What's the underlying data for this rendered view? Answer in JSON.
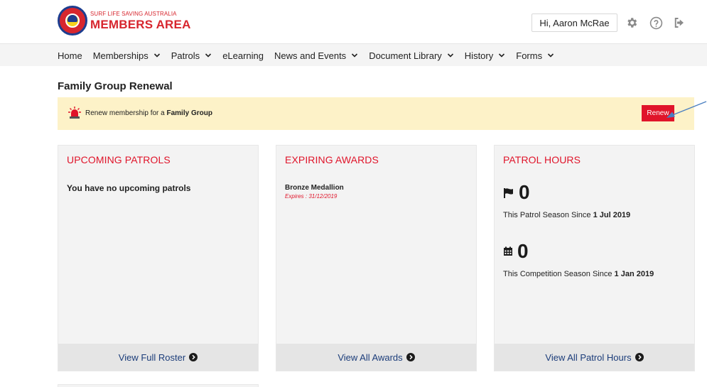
{
  "header": {
    "logo_subtitle": "SURF LIFE SAVING AUSTRALIA",
    "logo_title": "MEMBERS AREA",
    "greeting": "Hi, Aaron McRae",
    "icons": [
      "gear-icon",
      "help-icon",
      "logout-icon"
    ]
  },
  "nav": {
    "items": [
      {
        "label": "Home",
        "has_dropdown": false
      },
      {
        "label": "Memberships",
        "has_dropdown": true
      },
      {
        "label": "Patrols",
        "has_dropdown": true
      },
      {
        "label": "eLearning",
        "has_dropdown": false
      },
      {
        "label": "News and Events",
        "has_dropdown": true
      },
      {
        "label": "Document Library",
        "has_dropdown": true
      },
      {
        "label": "History",
        "has_dropdown": true
      },
      {
        "label": "Forms",
        "has_dropdown": true
      }
    ]
  },
  "page": {
    "title": "Family Group Renewal"
  },
  "alert": {
    "text_prefix": "Renew membership for a ",
    "text_bold": "Family Group",
    "button_label": "Renew",
    "icon": "siren-icon"
  },
  "cards": {
    "upcoming": {
      "title": "UPCOMING PATROLS",
      "empty_text": "You have no upcoming patrols",
      "footer": "View Full Roster"
    },
    "awards": {
      "title": "EXPIRING AWARDS",
      "items": [
        {
          "name": "Bronze Medallion",
          "expires": "Expires : 31/12/2019"
        }
      ],
      "footer": "View All Awards"
    },
    "hours": {
      "title": "PATROL HOURS",
      "patrol_value": "0",
      "patrol_text": "This Patrol Season Since ",
      "patrol_since": "1 Jul 2019",
      "competition_value": "0",
      "competition_text": "This Competition Season Since ",
      "competition_since": "1 Jan 2019",
      "footer": "View All Patrol Hours"
    }
  },
  "colors": {
    "accent_red": "#e0142a",
    "alert_bg": "#fdf2c8",
    "link_blue": "#1c3d7a",
    "card_bg": "#f3f3f3"
  }
}
